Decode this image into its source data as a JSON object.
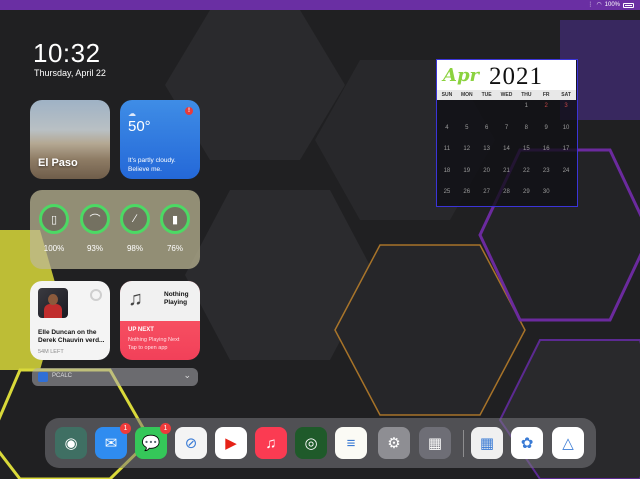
{
  "status": {
    "battery_pct": "100%"
  },
  "clock": {
    "time": "10:32",
    "date": "Thursday, April 22"
  },
  "photo": {
    "label": "El Paso"
  },
  "weather": {
    "temp": "50°",
    "description": "It's partly cloudy. Believe me.",
    "alert": "!"
  },
  "batteries": {
    "items": [
      {
        "icon": "ipad-icon",
        "glyph": "▯",
        "pct": "100%"
      },
      {
        "icon": "headphones-icon",
        "glyph": "⌒",
        "pct": "93%"
      },
      {
        "icon": "pencil-icon",
        "glyph": "∕",
        "pct": "98%"
      },
      {
        "icon": "airpod-case-icon",
        "glyph": "▮",
        "pct": "76%"
      }
    ],
    "ring_color": "#4cd964"
  },
  "podcast": {
    "title": "Elle Duncan on the Derek Chauvin verd...",
    "time_left": "54M LEFT"
  },
  "music": {
    "now_playing": "Nothing Playing",
    "up_next": "UP NEXT",
    "line1": "Nothing Playing Next",
    "line2": "Tap to open app"
  },
  "stack": {
    "label": "PCALC"
  },
  "calendar": {
    "month": "Apr",
    "year": "2021",
    "dow": [
      "SUN",
      "MON",
      "TUE",
      "WED",
      "THU",
      "FR",
      "SAT"
    ],
    "days": [
      "",
      "",
      "",
      "",
      "1",
      "2",
      "3",
      "4",
      "5",
      "6",
      "7",
      "8",
      "9",
      "10",
      "11",
      "12",
      "13",
      "14",
      "15",
      "16",
      "17",
      "18",
      "19",
      "20",
      "21",
      "22",
      "23",
      "24",
      "25",
      "26",
      "27",
      "28",
      "29",
      "30",
      ""
    ],
    "border_color": "#3b34d8",
    "month_color": "#8bd23f"
  },
  "dock": {
    "apps": [
      {
        "name": "screenshot-app-icon",
        "glyph": "◉",
        "bg": "#3f6f63",
        "badge": ""
      },
      {
        "name": "mail-icon",
        "glyph": "✉",
        "bg": "#2f8cf0",
        "badge": "1"
      },
      {
        "name": "messages-icon",
        "glyph": "💬",
        "bg": "#35c759",
        "badge": "1"
      },
      {
        "name": "safari-icon",
        "glyph": "⊘",
        "bg": "#f4f4f4",
        "badge": ""
      },
      {
        "name": "youtube-icon",
        "glyph": "▶",
        "bg": "#ffffff",
        "badge": ""
      },
      {
        "name": "music-icon",
        "glyph": "♫",
        "bg": "#fb3b52",
        "badge": ""
      },
      {
        "name": "overcast-icon",
        "glyph": "◎",
        "bg": "#1f5a2a",
        "badge": ""
      },
      {
        "name": "notes-icon",
        "glyph": "≡",
        "bg": "#fbfbf5",
        "badge": ""
      },
      {
        "name": "settings-icon",
        "glyph": "⚙",
        "bg": "#8e8e93",
        "badge": ""
      },
      {
        "name": "app-folder-icon",
        "glyph": "▦",
        "bg": "#6e6e76",
        "badge": ""
      },
      {
        "name": "app-library-icon",
        "glyph": "▦",
        "bg": "#f0f0f0",
        "badge": ""
      },
      {
        "name": "photos-icon",
        "glyph": "✿",
        "bg": "#ffffff",
        "badge": ""
      },
      {
        "name": "google-drive-icon",
        "glyph": "△",
        "bg": "#ffffff",
        "badge": ""
      }
    ]
  }
}
